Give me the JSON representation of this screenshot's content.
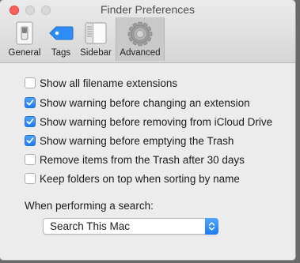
{
  "window": {
    "title": "Finder Preferences"
  },
  "tabs": [
    {
      "label": "General",
      "icon": "general-switch-icon",
      "selected": false
    },
    {
      "label": "Tags",
      "icon": "tag-icon",
      "selected": false
    },
    {
      "label": "Sidebar",
      "icon": "sidebar-icon",
      "selected": false
    },
    {
      "label": "Advanced",
      "icon": "gear-icon",
      "selected": true
    }
  ],
  "options": [
    {
      "label": "Show all filename extensions",
      "checked": false
    },
    {
      "label": "Show warning before changing an extension",
      "checked": true
    },
    {
      "label": "Show warning before removing from iCloud Drive",
      "checked": true
    },
    {
      "label": "Show warning before emptying the Trash",
      "checked": true
    },
    {
      "label": "Remove items from the Trash after 30 days",
      "checked": false
    },
    {
      "label": "Keep folders on top when sorting by name",
      "checked": false
    }
  ],
  "search": {
    "label": "When performing a search:",
    "selected_option": "Search This Mac"
  },
  "colors": {
    "accent": "#1d7cf2",
    "close_button": "#fc605c",
    "tag_blue": "#2f8cf5"
  }
}
